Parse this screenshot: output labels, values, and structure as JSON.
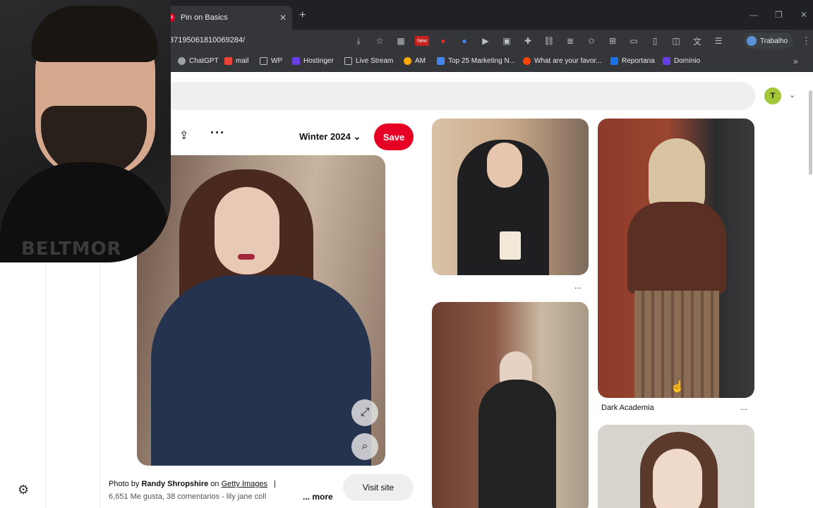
{
  "browser": {
    "tab_title": "Pin on Basics",
    "tab_favicon": "P",
    "new_tab": "+",
    "url": "37195061810069284/",
    "profile_label": "Trabalho",
    "bookmarks": [
      {
        "label": "ChatGPT",
        "color": "#9aa0a6"
      },
      {
        "label": "mail",
        "color": "#ea4335"
      },
      {
        "label": "WP",
        "color": "#bdc1c6"
      },
      {
        "label": "Hostinger",
        "color": "#673de6"
      },
      {
        "label": "Live Stream",
        "color": "#bdc1c6"
      },
      {
        "label": "AM",
        "color": "#f9ab00"
      },
      {
        "label": "Top 25 Marketing N...",
        "color": "#4285f4"
      },
      {
        "label": "What are your favor...",
        "color": "#ff4500"
      },
      {
        "label": "Reportana",
        "color": "#1a73e8"
      },
      {
        "label": "Domínio",
        "color": "#673de6"
      }
    ],
    "new_badge": "New"
  },
  "header": {
    "user_initial": "T"
  },
  "closeup": {
    "board_name": "Winter 2024",
    "save_label": "Save",
    "attribution": {
      "prefix": "Photo by",
      "author": "Randy Shropshire",
      "on": "on",
      "source": "Getty Images",
      "separator": "|"
    },
    "stats": "6,651 Me gusta, 38 comentarios - lily jane coll",
    "more_label": "... more",
    "visit_label": "Visit site"
  },
  "pins": [
    {
      "title": "",
      "menu": "..."
    },
    {
      "title": "",
      "menu": ""
    },
    {
      "title": "Dark Academia",
      "menu": "..."
    },
    {
      "title": "",
      "menu": ""
    }
  ],
  "webcam": {
    "logo_text": "BELTMOR"
  }
}
